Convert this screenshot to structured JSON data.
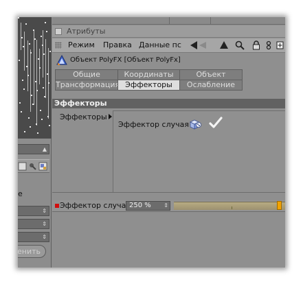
{
  "left_panel": {
    "label_fragment": "е",
    "button_fragment": "енить"
  },
  "attributes": {
    "panel_title": "Атрибуты",
    "menu": [
      "Режим",
      "Правка",
      "Данные пс"
    ],
    "object_title": "Объект PolyFX [Объект PolyFx]",
    "tabs_row1": [
      "Общие",
      "Координаты",
      "Объект"
    ],
    "tabs_row2": [
      "Трансформация",
      "Эффекторы",
      "Ослабление"
    ],
    "active_tab": "Эффекторы",
    "section_title": "Эффекторы",
    "effectors_label": "Эффекторы",
    "effector_items": [
      {
        "name": "Эффектор случая",
        "enabled": true
      }
    ],
    "slider": {
      "label": "Эффектор случая",
      "value": "250 %",
      "position_fraction": 0.97,
      "accent_color": "#f2a300",
      "marker_color": "#d10e0e"
    }
  },
  "icons": {
    "menubar": [
      "grip-icon",
      "arrow-left-icon",
      "arrow-up-icon",
      "search-icon",
      "lock-icon",
      "node-icon",
      "new-window-icon"
    ],
    "object": "polyfx-object-icon",
    "effector": "random-effector-icon",
    "checkmark": "checkmark-icon"
  }
}
